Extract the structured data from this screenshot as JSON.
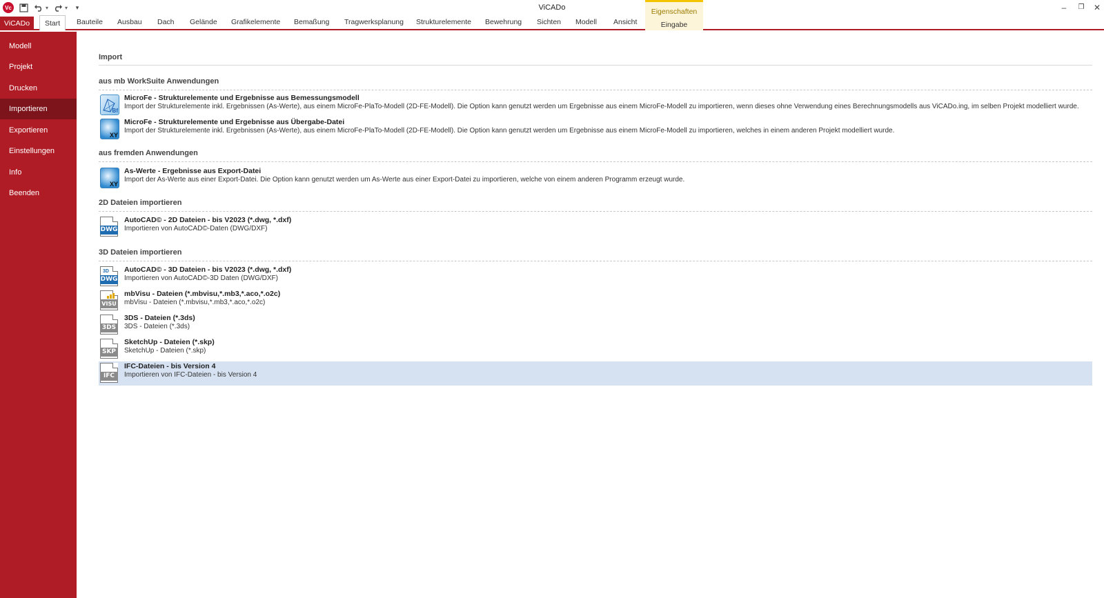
{
  "window": {
    "title": "ViCADo",
    "app_logo": "Vc",
    "qat_icons": [
      "save-icon",
      "undo-icon",
      "redo-icon",
      "customize-icon"
    ],
    "controls": {
      "minimize": "–",
      "restore": "❐",
      "close": "✕"
    }
  },
  "ribbon": {
    "file_tab": "ViCADo",
    "tabs": [
      "Start",
      "Bauteile",
      "Ausbau",
      "Dach",
      "Gelände",
      "Grafikelemente",
      "Bemaßung",
      "Tragwerksplanung",
      "Strukturelemente",
      "Bewehrung",
      "Sichten",
      "Modell",
      "Ansicht"
    ],
    "active_tab": "Start",
    "context_group": {
      "label": "Eigenschaften",
      "tab": "Eingabe",
      "color": "#f4c400"
    },
    "help": "?",
    "collapse": "^"
  },
  "sidebar": {
    "items": [
      {
        "label": "Modell"
      },
      {
        "label": "Projekt"
      },
      {
        "label": "Drucken"
      },
      {
        "label": "Importieren",
        "active": true
      },
      {
        "label": "Exportieren"
      },
      {
        "label": "Einstellungen"
      },
      {
        "label": "Info"
      },
      {
        "label": "Beenden"
      }
    ],
    "color": "#b01c25",
    "active_color": "#7d141b"
  },
  "main": {
    "title": "Import",
    "sections": [
      {
        "title": "aus mb WorkSuite Anwendungen",
        "entries": [
          {
            "icon": "microfe-icon",
            "title": "MicroFe - Strukturelemente und Ergebnisse aus Bemessungsmodell",
            "desc": "Import der Strukturelemente inkl. Ergebnissen (As-Werte), aus einem MicroFe-PlaTo-Modell (2D-FE-Modell). Die Option kann genutzt werden um Ergebnisse aus einem MicroFe-Modell zu importieren, wenn dieses ohne Verwendung  eines Berechnungsmodells aus ViCADo.ing, im selben Projekt modelliert wurde."
          },
          {
            "icon": "xy-globe-icon",
            "title": "MicroFe - Strukturelemente und Ergebnisse aus Übergabe-Datei",
            "desc": "Import der Strukturelemente inkl. Ergebnissen (As-Werte), aus einem MicroFe-PlaTo-Modell (2D-FE-Modell). Die Option kann genutzt werden um Ergebnisse aus einem MicroFe-Modell zu importieren, welches in einem anderen Projekt modelliert wurde."
          }
        ]
      },
      {
        "title": "aus fremden Anwendungen",
        "entries": [
          {
            "icon": "xy-globe-icon",
            "title": "As-Werte - Ergebnisse aus Export-Datei",
            "desc": "Import der As-Werte aus einer Export-Datei. Die Option kann genutzt werden um As-Werte aus einer Export-Datei zu importieren, welche von einem anderen Programm erzeugt wurde."
          }
        ]
      },
      {
        "title": "2D Dateien importieren",
        "entries": [
          {
            "icon": "dwg-file-icon",
            "badge": "DWG",
            "title": "AutoCAD© - 2D Dateien - bis V2023 (*.dwg, *.dxf)",
            "desc": "Importieren von AutoCAD©-Daten (DWG/DXF)"
          }
        ]
      },
      {
        "title": "3D Dateien importieren",
        "entries": [
          {
            "icon": "dwg3d-file-icon",
            "badge": "DWG",
            "top": "3D",
            "title": "AutoCAD© - 3D Dateien - bis V2023 (*.dwg, *.dxf)",
            "desc": "Importieren von AutoCAD©-3D Daten (DWG/DXF)"
          },
          {
            "icon": "visu-file-icon",
            "badge": "VISU",
            "title": "mbVisu - Dateien (*.mbvisu,*.mb3,*.aco,*.o2c)",
            "desc": "mbVisu - Dateien (*.mbvisu,*.mb3,*.aco,*.o2c)"
          },
          {
            "icon": "3ds-file-icon",
            "badge": "3DS",
            "title": "3DS - Dateien (*.3ds)",
            "desc": "3DS - Dateien (*.3ds)"
          },
          {
            "icon": "skp-file-icon",
            "badge": "SKP",
            "title": "SketchUp - Dateien (*.skp)",
            "desc": "SketchUp - Dateien (*.skp)"
          },
          {
            "icon": "ifc-file-icon",
            "badge": "IFC",
            "title": "IFC-Dateien - bis Version 4",
            "desc": "Importieren von IFC-Dateien - bis Version 4",
            "selected": true
          }
        ]
      }
    ]
  }
}
